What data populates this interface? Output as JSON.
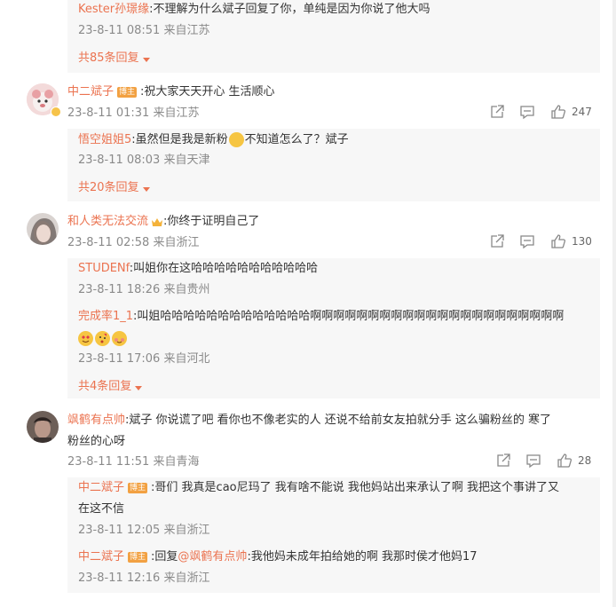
{
  "thread0": {
    "reply1": {
      "name": "Kester孙璟缘",
      "text": ":不理解为什么斌子回复了你，单纯是因为你说了他大吗",
      "meta": "23-8-11 08:51 来自江苏"
    },
    "more": "共85条回复"
  },
  "comment1": {
    "name": "中二斌子",
    "badge": "博主",
    "text": ":祝大家天天开心  生活顺心",
    "meta": "23-8-11 01:31 来自江苏",
    "likes": "247",
    "reply1": {
      "name": "悟空姐姐5",
      "text_a": ":虽然但是我是新粉",
      "text_b": "不知道怎么了？斌子",
      "meta": "23-8-11 08:03 来自天津"
    },
    "more": "共20条回复"
  },
  "comment2": {
    "name": "和人类无法交流",
    "text": ":你终于证明自己了",
    "meta": "23-8-11 02:58 来自浙江",
    "likes": "130",
    "reply1": {
      "name": "STUDENf",
      "text": ":叫姐你在这哈哈哈哈哈哈哈哈哈哈哈",
      "meta": "23-8-11 18:26 来自贵州"
    },
    "reply2": {
      "name": "完成率1_1",
      "text": ":叫姐哈哈哈哈哈哈哈哈哈哈哈哈哈啊啊啊啊啊啊啊啊啊啊啊啊啊啊啊啊啊啊啊啊啊啊",
      "meta": "23-8-11 17:06 来自河北"
    },
    "more": "共4条回复"
  },
  "comment3": {
    "name": "飒鹤有点帅",
    "text_line1": ":斌子 你说谎了吧 看你也不像老实的人 还说不给前女友拍就分手 这么骗粉丝的 寒了",
    "text_line2": "粉丝的心呀",
    "meta": "23-8-11 11:51 来自青海",
    "likes": "28",
    "reply1": {
      "name": "中二斌子",
      "badge": "博主",
      "text_line1": ":哥们 我真是cao尼玛了 我有啥不能说 我他妈站出来承认了啊 我把这个事讲了又",
      "text_line2": "在这不信",
      "meta": "23-8-11 12:05 来自浙江"
    },
    "reply2": {
      "name": "中二斌子",
      "badge": "博主",
      "prefix": ":回复",
      "mention": "@飒鹤有点帅",
      "text": ":我他妈未成年拍给她的啊 我那时侯才他妈17",
      "meta": "23-8-11 12:16 来自浙江"
    }
  },
  "colors": {
    "accent": "#eb7350",
    "meta": "#8a8a8a",
    "reply_bg": "#f7f7f7"
  }
}
